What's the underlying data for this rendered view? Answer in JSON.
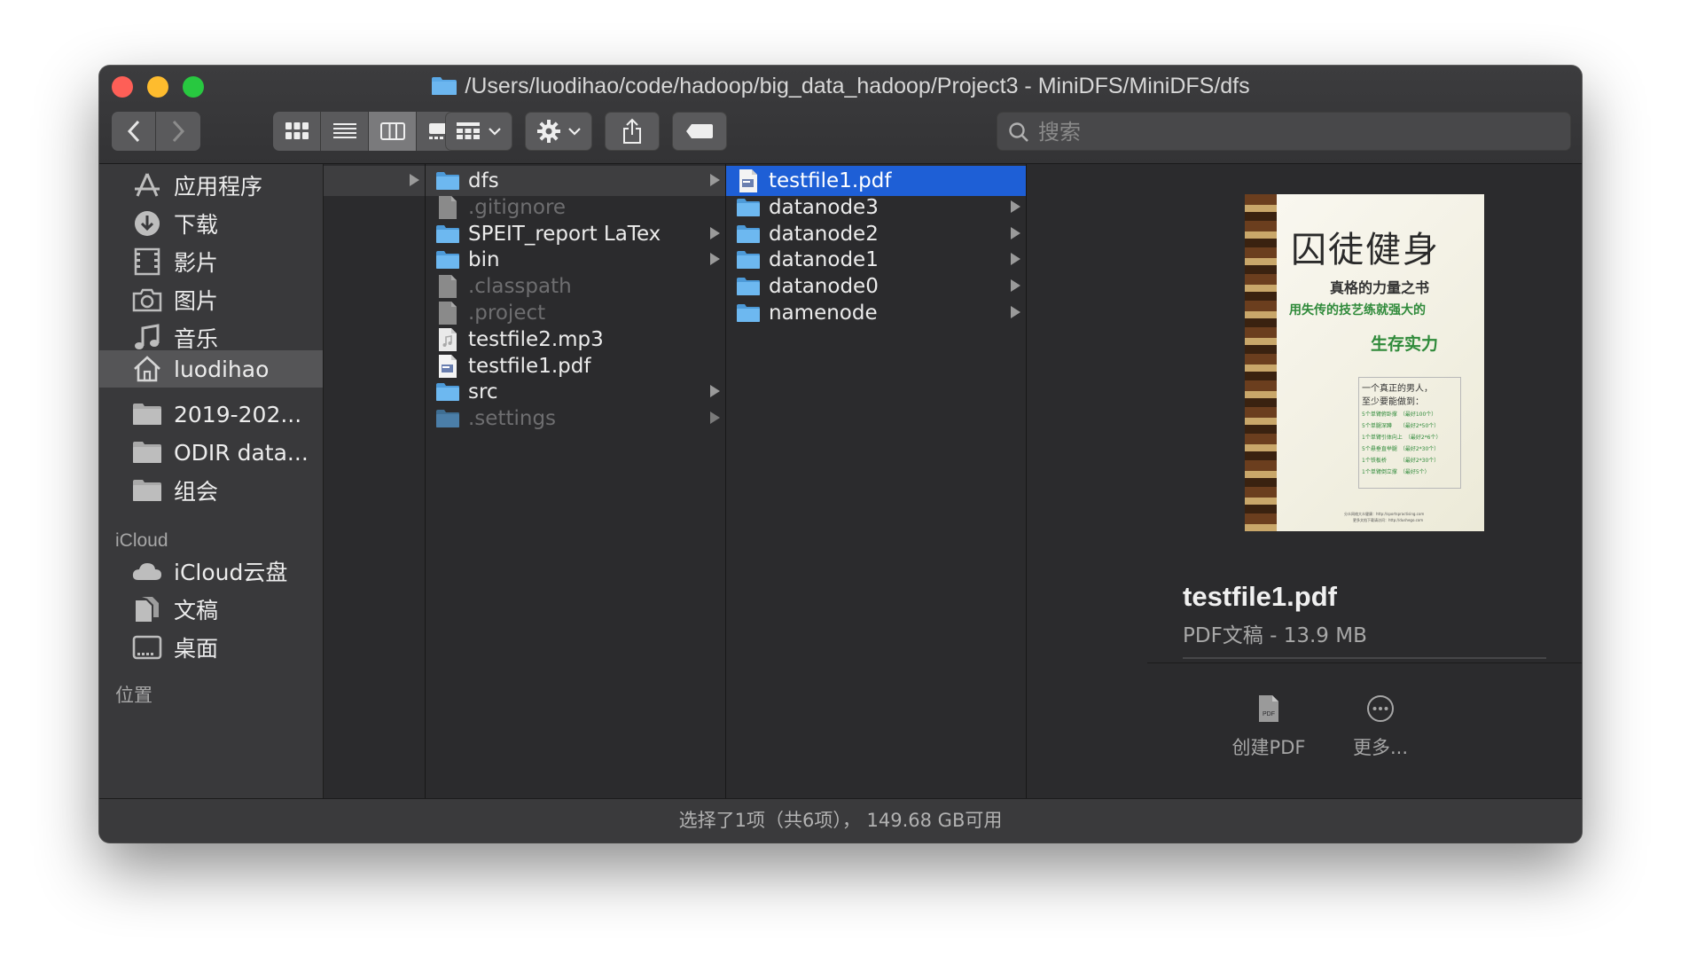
{
  "window": {
    "title": "/Users/luodihao/code/hadoop/big_data_hadoop/Project3 - MiniDFS/MiniDFS/dfs"
  },
  "toolbar": {
    "view_icons": [
      "icon-view-icon",
      "list-view-icon",
      "column-view-icon",
      "gallery-view-icon"
    ],
    "active_view": "column-view",
    "search_placeholder": "搜索"
  },
  "sidebar": {
    "favorites": [
      {
        "label": "应用程序",
        "icon": "applications-icon"
      },
      {
        "label": "下载",
        "icon": "downloads-icon"
      },
      {
        "label": "影片",
        "icon": "movies-icon"
      },
      {
        "label": "图片",
        "icon": "pictures-icon"
      },
      {
        "label": "音乐",
        "icon": "music-icon"
      },
      {
        "label": "luodihao",
        "icon": "home-icon",
        "selected": true
      },
      {
        "label": "2019-202...",
        "icon": "folder-icon"
      },
      {
        "label": "ODIR data...",
        "icon": "folder-icon"
      },
      {
        "label": "组会",
        "icon": "folder-icon"
      }
    ],
    "icloud_header": "iCloud",
    "icloud": [
      {
        "label": "iCloud云盘",
        "icon": "cloud-icon"
      },
      {
        "label": "文稿",
        "icon": "documents-icon"
      },
      {
        "label": "桌面",
        "icon": "desktop-icon"
      }
    ],
    "locations_header": "位置"
  },
  "column2": [
    {
      "name": "dfs",
      "type": "folder",
      "has_children": true,
      "highlight": true
    },
    {
      "name": ".gitignore",
      "type": "file",
      "dim": true
    },
    {
      "name": "SPEIT_report LaTex",
      "type": "folder",
      "has_children": true
    },
    {
      "name": "bin",
      "type": "folder",
      "has_children": true
    },
    {
      "name": ".classpath",
      "type": "file",
      "dim": true
    },
    {
      "name": ".project",
      "type": "file",
      "dim": true
    },
    {
      "name": "testfile2.mp3",
      "type": "audio"
    },
    {
      "name": "testfile1.pdf",
      "type": "pdf"
    },
    {
      "name": "src",
      "type": "folder",
      "has_children": true
    },
    {
      "name": ".settings",
      "type": "folder",
      "has_children": true,
      "dim": true
    }
  ],
  "column3": [
    {
      "name": "testfile1.pdf",
      "type": "pdf",
      "selected": true
    },
    {
      "name": "datanode3",
      "type": "folder",
      "has_children": true
    },
    {
      "name": "datanode2",
      "type": "folder",
      "has_children": true
    },
    {
      "name": "datanode1",
      "type": "folder",
      "has_children": true
    },
    {
      "name": "datanode0",
      "type": "folder",
      "has_children": true
    },
    {
      "name": "namenode",
      "type": "folder",
      "has_children": true
    }
  ],
  "preview": {
    "cover": {
      "title": "囚徒健身",
      "subtitle": "真格的力量之书",
      "tagline": "用失传的技艺练就强大的",
      "tagline2": "生存实力",
      "box_title": "一个真正的男人，",
      "box_title2": "至少要能做到：",
      "box_lines": [
        "5个单臂俯卧撑　（最好100个）",
        "5个单腿深蹲　　（最好2*50个）",
        "1个单臂引体向上　（最好2*6个）",
        "5个悬垂直举腿　（最好2*30个）",
        "1个铁板桥　　　（最好2*30个）",
        "1个单臂倒立撑　（最好5个）"
      ],
      "footer": "分众网络大众健康：http://sportspractising.com",
      "footer2": "更多文档下载请访问：http://dushego.com"
    },
    "file_name": "testfile1.pdf",
    "file_meta": "PDF文稿 - 13.9 MB",
    "actions": [
      {
        "label": "创建PDF",
        "icon": "pdf-icon"
      },
      {
        "label": "更多...",
        "icon": "more-icon"
      }
    ]
  },
  "status": "选择了1项（共6项）， 149.68 GB可用",
  "colors": {
    "selection": "#1e5fd6",
    "folder": "#5aa8e6",
    "window_bg": "#2b2b2d"
  }
}
